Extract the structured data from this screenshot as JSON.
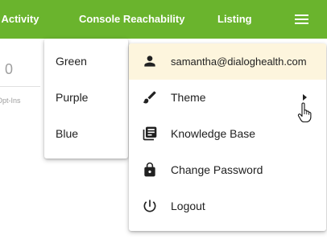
{
  "topbar": {
    "nav": [
      "t Activity",
      "Console Reachability",
      "Listing"
    ],
    "menu_icon": "hamburger-menu-icon",
    "bg_color": "#6ab42d"
  },
  "background": {
    "stat_value": "0",
    "stat_caption": "Opt-Ins"
  },
  "theme_submenu": {
    "options": [
      "Green",
      "Purple",
      "Blue"
    ]
  },
  "user_menu": {
    "user_email": "samantha@dialoghealth.com",
    "items": [
      {
        "label": "Theme",
        "icon": "paintbrush-icon"
      },
      {
        "label": "Knowledge Base",
        "icon": "library-books-icon"
      },
      {
        "label": "Change Password",
        "icon": "lock-icon"
      },
      {
        "label": "Logout",
        "icon": "power-icon"
      }
    ],
    "highlight_color": "#fdf5dd"
  }
}
